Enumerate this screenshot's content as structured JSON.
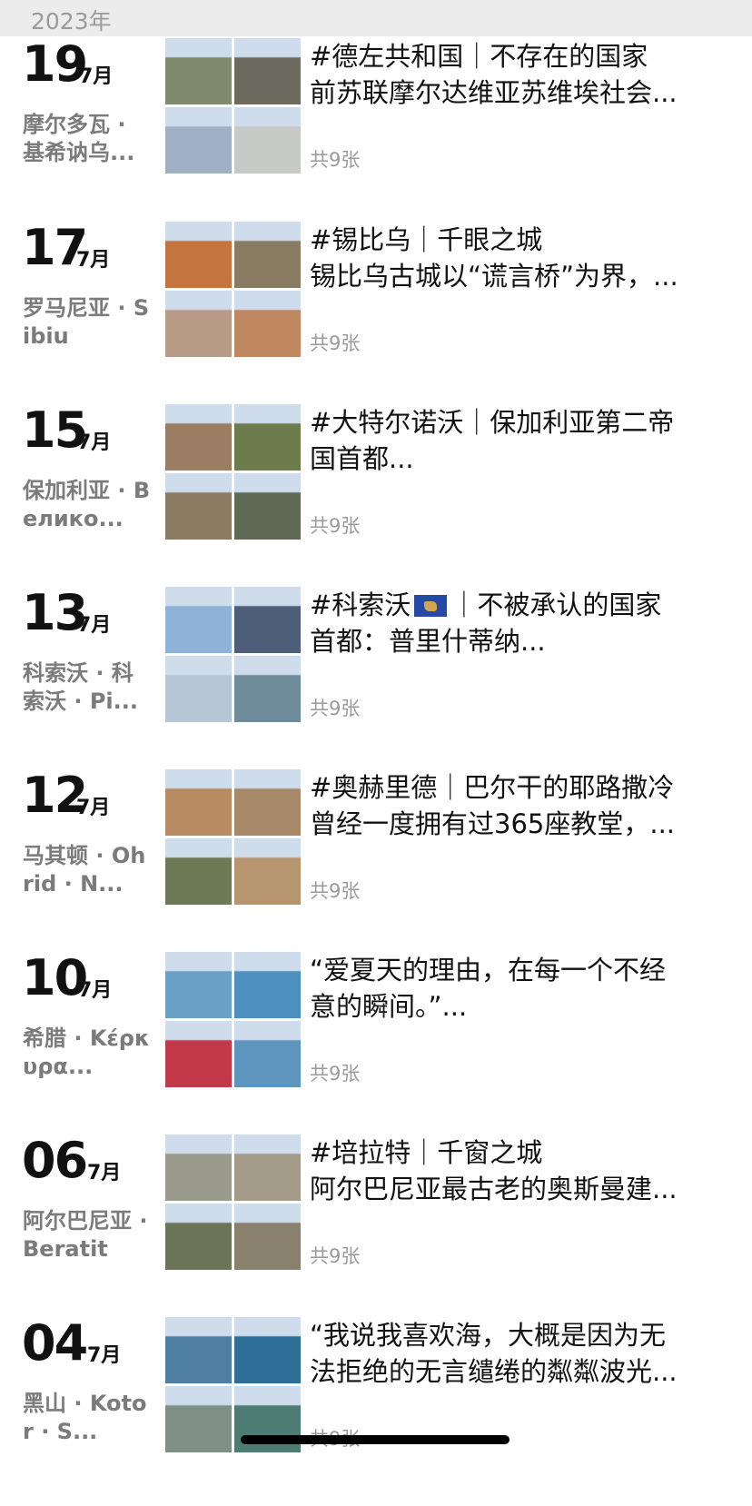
{
  "year_header": "2023年",
  "count_label": "共9张",
  "entries": [
    {
      "day": "19",
      "month": "7月",
      "location": "摩尔多瓦 · 基希讷乌...",
      "title": "#德左共和国｜不存在的国家",
      "text": "前苏联摩尔达维亚苏维埃社会...",
      "colors": [
        "#7f8a6e",
        "#6d6a5f",
        "#9fb0c4",
        "#c7c9c7"
      ]
    },
    {
      "day": "17",
      "month": "7月",
      "location": "罗马尼亚 · Sibiu",
      "title": "#锡比乌｜千眼之城",
      "text": "锡比乌古城以“谎言桥”为界，...",
      "colors": [
        "#c4743e",
        "#8a7c62",
        "#b79b86",
        "#c08860"
      ]
    },
    {
      "day": "15",
      "month": "7月",
      "location": "保加利亚 · Велико...",
      "title": "#大特尔诺沃｜保加利亚第二帝",
      "text": "国首都...",
      "colors": [
        "#9a7d62",
        "#6d7c4c",
        "#8d7a62",
        "#5f6b55"
      ]
    },
    {
      "day": "13",
      "month": "7月",
      "location": "科索沃 · 科索沃 · Pi...",
      "title": "#科索沃",
      "title_after_flag": "｜不被承认的国家",
      "text": "首都：普里什蒂纳...",
      "colors": [
        "#8fb3d8",
        "#4d5f78",
        "#b7c6d6",
        "#6f8c9a"
      ]
    },
    {
      "day": "12",
      "month": "7月",
      "location": "马其顿 · Ohrid · N...",
      "title": "#奥赫里德｜巴尔干的耶路撒冷",
      "text": "曾经一度拥有过365座教堂，...",
      "colors": [
        "#b98b63",
        "#a7896a",
        "#6c7a55",
        "#b6956f"
      ]
    },
    {
      "day": "10",
      "month": "7月",
      "location": "希腊 · Κέρκυρα...",
      "title": "“爱夏天的理由，在每一个不经",
      "text": "意的瞬间。”...",
      "colors": [
        "#6a9fc6",
        "#4d8fbf",
        "#c23a4a",
        "#5e95bf"
      ]
    },
    {
      "day": "06",
      "month": "7月",
      "location": "阿尔巴尼亚 · Beratit",
      "title": "#培拉特｜千窗之城",
      "text": "阿尔巴尼亚最古老的奥斯曼建...",
      "colors": [
        "#9a9a8d",
        "#a39a87",
        "#6b7456",
        "#89806d"
      ]
    },
    {
      "day": "04",
      "month": "7月",
      "location": "黑山 · Kotor · S...",
      "title": "“我说我喜欢海，大概是因为无",
      "text": "法拒绝的无言缱绻的粼粼波光...",
      "colors": [
        "#4f7ea3",
        "#2f6e96",
        "#7f8e86",
        "#4d7c72"
      ]
    }
  ]
}
